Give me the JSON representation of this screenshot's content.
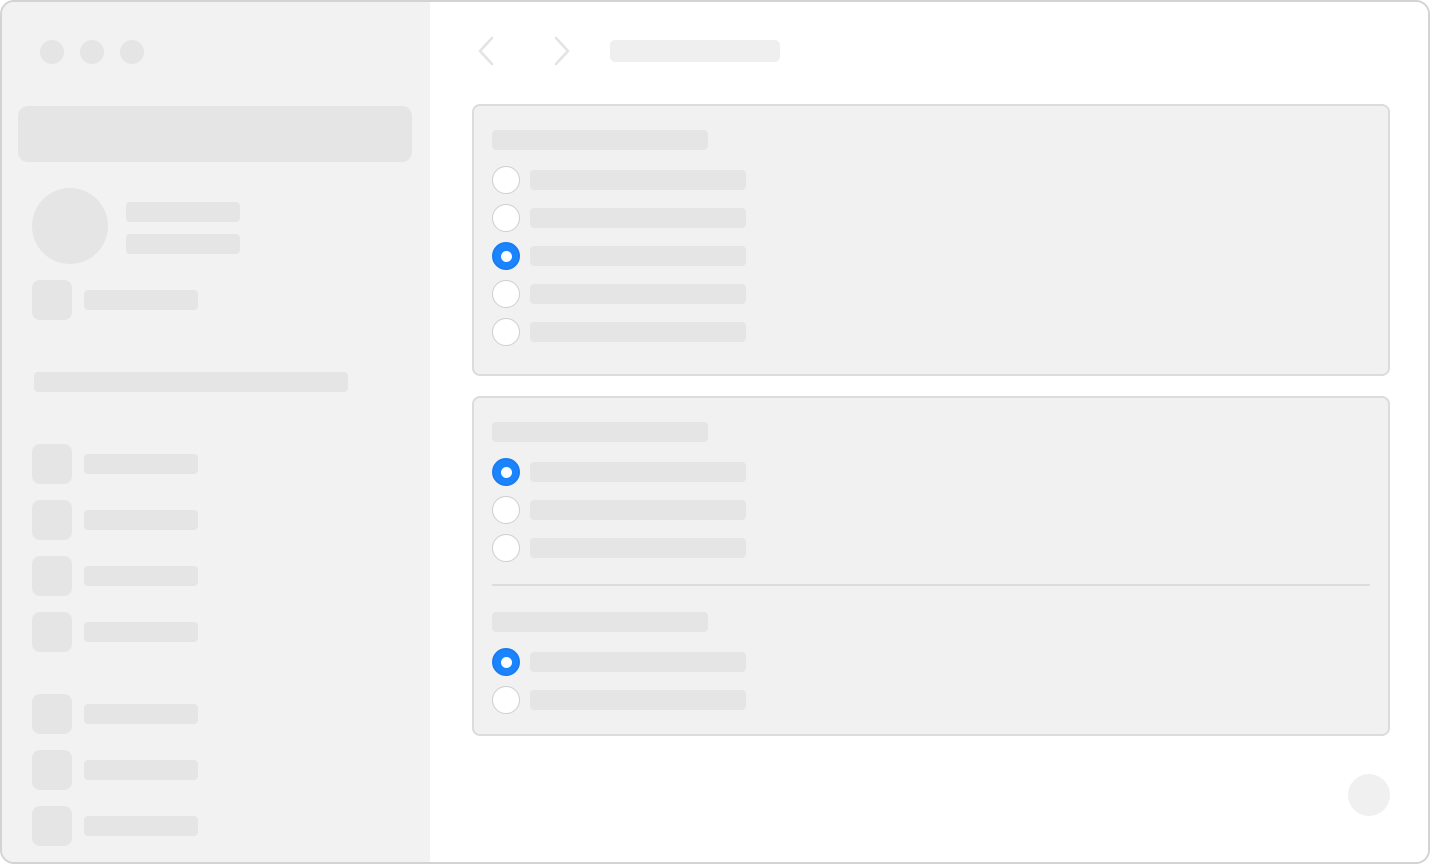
{
  "window": {
    "title": ""
  },
  "sidebar": {
    "search": {
      "placeholder": ""
    },
    "profile": {
      "name": "",
      "subtitle": ""
    },
    "top_item": {
      "label": ""
    },
    "section_label": "",
    "items": [
      {
        "label": ""
      },
      {
        "label": ""
      },
      {
        "label": ""
      },
      {
        "label": ""
      },
      {
        "label": ""
      },
      {
        "label": ""
      },
      {
        "label": ""
      }
    ]
  },
  "toolbar": {
    "breadcrumb": ""
  },
  "groups": [
    {
      "title": "",
      "options": [
        {
          "label": "",
          "checked": false
        },
        {
          "label": "",
          "checked": false
        },
        {
          "label": "",
          "checked": true
        },
        {
          "label": "",
          "checked": false
        },
        {
          "label": "",
          "checked": false
        }
      ]
    },
    {
      "title": "",
      "options": [
        {
          "label": "",
          "checked": true
        },
        {
          "label": "",
          "checked": false
        },
        {
          "label": "",
          "checked": false
        }
      ]
    },
    {
      "title": "",
      "options": [
        {
          "label": "",
          "checked": true
        },
        {
          "label": "",
          "checked": false
        }
      ]
    }
  ],
  "colors": {
    "accent": "#1a84ff",
    "sidebar_bg": "#f2f2f2",
    "placeholder": "#e5e5e5",
    "group_bg": "#f1f1f1"
  },
  "icons": {
    "back": "chevron-left-icon",
    "forward": "chevron-right-icon",
    "help": "help-icon"
  }
}
